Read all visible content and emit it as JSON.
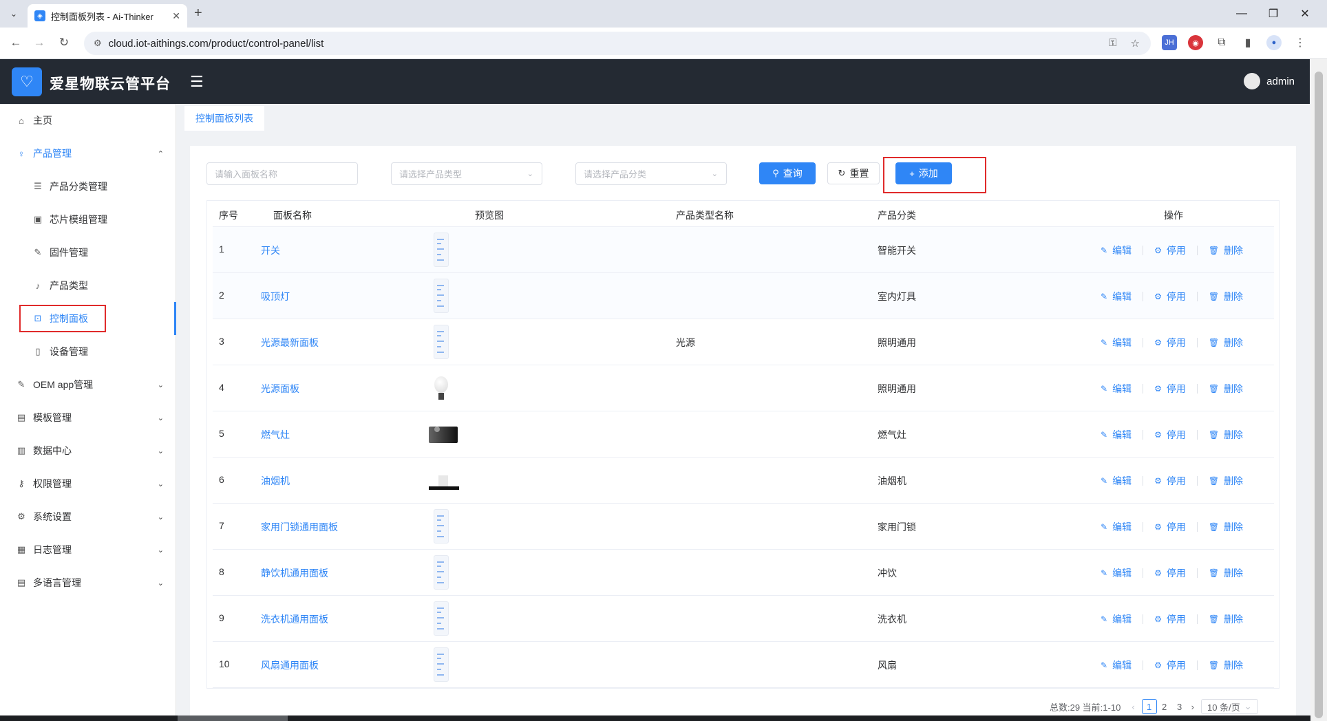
{
  "browser": {
    "tab_title": "控制面板列表 - Ai-Thinker",
    "url": "cloud.iot-aithings.com/product/control-panel/list",
    "extensions": [
      {
        "name": "jh-extension-icon",
        "label": "JH",
        "color": "#4b6fd6"
      },
      {
        "name": "shield-extension-icon",
        "label": "",
        "color": "#d9343b"
      },
      {
        "name": "puzzle-extension-icon",
        "label": "",
        "color": "#ffffff"
      }
    ]
  },
  "header": {
    "brand": "爱星物联云管平台",
    "user": "admin"
  },
  "sidebar": {
    "items": [
      {
        "label": "主页",
        "icon": "home-icon"
      },
      {
        "label": "产品管理",
        "icon": "lightbulb-icon"
      },
      {
        "label": "产品分类管理",
        "icon": "list-icon"
      },
      {
        "label": "芯片模组管理",
        "icon": "chip-icon"
      },
      {
        "label": "固件管理",
        "icon": "wrench-icon"
      },
      {
        "label": "产品类型",
        "icon": "bell-icon"
      },
      {
        "label": "控制面板",
        "icon": "chart-icon"
      },
      {
        "label": "设备管理",
        "icon": "device-icon"
      },
      {
        "label": "OEM app管理",
        "icon": "tool-icon"
      },
      {
        "label": "模板管理",
        "icon": "document-icon"
      },
      {
        "label": "数据中心",
        "icon": "bar-chart-icon"
      },
      {
        "label": "权限管理",
        "icon": "user-key-icon"
      },
      {
        "label": "系统设置",
        "icon": "gear-icon"
      },
      {
        "label": "日志管理",
        "icon": "log-icon"
      },
      {
        "label": "多语言管理",
        "icon": "language-icon"
      }
    ]
  },
  "tags": {
    "current": "控制面板列表"
  },
  "filters": {
    "name_placeholder": "请输入面板名称",
    "type_placeholder": "请选择产品类型",
    "category_placeholder": "请选择产品分类",
    "query_label": "查询",
    "reset_label": "重置",
    "add_label": "添加"
  },
  "table": {
    "columns": [
      "序号",
      "面板名称",
      "预览图",
      "产品类型名称",
      "产品分类",
      "操作"
    ],
    "rows": [
      {
        "index": "1",
        "name": "开关",
        "preview": "phone",
        "type": "",
        "category": "智能开关"
      },
      {
        "index": "2",
        "name": "吸顶灯",
        "preview": "phone",
        "type": "",
        "category": "室内灯具"
      },
      {
        "index": "3",
        "name": "光源最新面板",
        "preview": "phone",
        "type": "光源",
        "category": "照明通用"
      },
      {
        "index": "4",
        "name": "光源面板",
        "preview": "bulb",
        "type": "",
        "category": "照明通用"
      },
      {
        "index": "5",
        "name": "燃气灶",
        "preview": "stove",
        "type": "",
        "category": "燃气灶"
      },
      {
        "index": "6",
        "name": "油烟机",
        "preview": "hood",
        "type": "",
        "category": "油烟机"
      },
      {
        "index": "7",
        "name": "家用门锁通用面板",
        "preview": "phone",
        "type": "",
        "category": "家用门锁"
      },
      {
        "index": "8",
        "name": "静饮机通用面板",
        "preview": "phone",
        "type": "",
        "category": "冲饮"
      },
      {
        "index": "9",
        "name": "洗衣机通用面板",
        "preview": "phone",
        "type": "",
        "category": "洗衣机"
      },
      {
        "index": "10",
        "name": "风扇通用面板",
        "preview": "phone",
        "type": "",
        "category": "风扇"
      }
    ],
    "actions": {
      "edit": "编辑",
      "disable": "停用",
      "delete": "删除"
    }
  },
  "pagination": {
    "total": "总数:29 当前:1-10",
    "pages": [
      "1",
      "2",
      "3"
    ],
    "page_size": "10 条/页"
  }
}
